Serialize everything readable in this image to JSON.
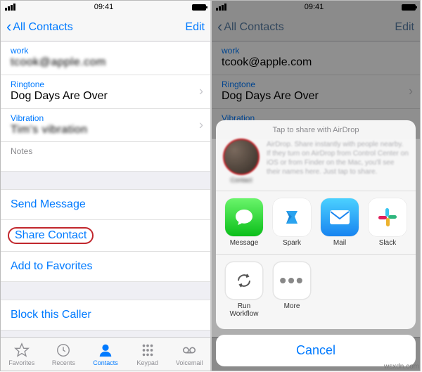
{
  "status": {
    "carrier_glyph": "••••",
    "time": "09:41",
    "battery": 100
  },
  "nav": {
    "back": "All Contacts",
    "edit": "Edit"
  },
  "left": {
    "work_k": "work",
    "work_v": "tcook@apple.com",
    "ring_k": "Ringtone",
    "ring_v": "Dog Days Are Over",
    "vib_k": "Vibration",
    "vib_v": "Tim's vibration",
    "notes_k": "Notes",
    "send": "Send Message",
    "share": "Share Contact",
    "fav": "Add to Favorites",
    "block": "Block this Caller"
  },
  "tabs": {
    "fav": "Favorites",
    "rec": "Recents",
    "con": "Contacts",
    "key": "Keypad",
    "vm": "Voicemail"
  },
  "right": {
    "work_k": "work",
    "work_v": "tcook@apple.com",
    "ring_k": "Ringtone",
    "ring_v": "Dog Days Are Over",
    "vib_k": "Vibration"
  },
  "sheet": {
    "hint": "Tap to share with AirDrop",
    "contact_name": "Contact",
    "air_desc": "AirDrop. Share instantly with people nearby. If they turn on AirDrop from Control Center on iOS or from Finder on the Mac, you'll see their names here. Just tap to share.",
    "apps": {
      "message": "Message",
      "spark": "Spark",
      "mail": "Mail",
      "slack": "Slack",
      "workflow": "Run Workflow",
      "more": "More"
    },
    "cancel": "Cancel"
  },
  "watermark": "wsxdn.com"
}
